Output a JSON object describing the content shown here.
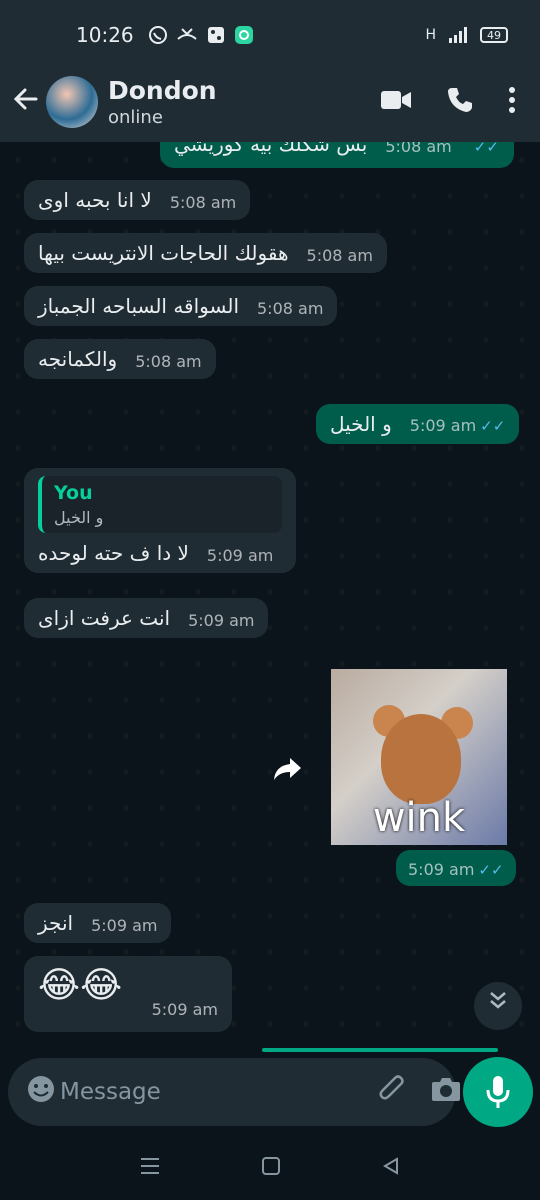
{
  "status_bar": {
    "time": "10:26",
    "signal": "H",
    "battery": "49"
  },
  "header": {
    "contact_name": "Dondon",
    "contact_status": "online"
  },
  "messages": [
    {
      "dir": "out",
      "text": "بس شكلك بيه كوريشي",
      "time": "5:08 am"
    },
    {
      "dir": "in",
      "text": "لا انا بحبه اوى",
      "time": "5:08 am"
    },
    {
      "dir": "in",
      "text": "هقولك الحاجات الانتريست بيها",
      "time": "5:08 am"
    },
    {
      "dir": "in",
      "text": "السواقه السباحه الجمباز",
      "time": "5:08 am"
    },
    {
      "dir": "in",
      "text": "والكمانجه",
      "time": "5:08 am"
    },
    {
      "dir": "out",
      "text": "و الخيل",
      "time": "5:09 am"
    },
    {
      "dir": "in",
      "reply_author": "You",
      "reply_text": "و الخيل",
      "text": "لا دا ف حته لوحده",
      "time": "5:09 am"
    },
    {
      "dir": "in",
      "text": "انت عرفت ازاى",
      "time": "5:09 am"
    },
    {
      "dir": "out",
      "sticker_caption": "wink",
      "time": "5:09 am"
    },
    {
      "dir": "in",
      "text": "انجز",
      "time": "5:09 am"
    },
    {
      "dir": "in",
      "text": "😂😂",
      "time": "5:09 am"
    }
  ],
  "composer": {
    "placeholder": "Message"
  },
  "icons": {
    "back": "arrow-left-icon",
    "video": "video-camera-icon",
    "call": "phone-icon",
    "menu": "more-vertical-icon",
    "emoji": "emoji-icon",
    "attach": "paperclip-icon",
    "camera": "camera-icon",
    "mic": "microphone-icon",
    "forward": "forward-icon",
    "scroll": "chevrons-down-icon"
  },
  "colors": {
    "incoming_bubble": "#202c33",
    "outgoing_bubble": "#005c4b",
    "accent": "#00a884",
    "read_ticks": "#53bdeb"
  }
}
